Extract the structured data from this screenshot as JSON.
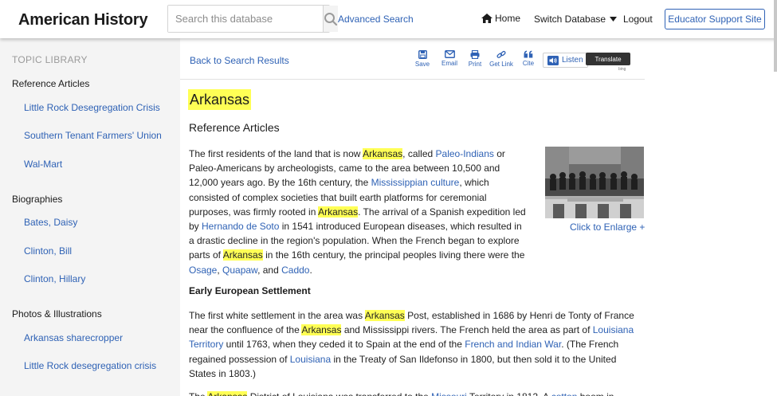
{
  "header": {
    "brand": "American History",
    "search_placeholder": "Search this database",
    "advanced_search": "Advanced Search",
    "home": "Home",
    "switch_database": "Switch Database",
    "logout": "Logout",
    "educator_support": "Educator Support Site"
  },
  "sidebar": {
    "library_title": "TOPIC LIBRARY",
    "groups": [
      {
        "heading": "Reference Articles",
        "items": [
          "Little Rock Desegregation Crisis",
          "Southern Tenant Farmers' Union",
          "Wal-Mart"
        ]
      },
      {
        "heading": "Biographies",
        "items": [
          "Bates, Daisy",
          "Clinton, Bill",
          "Clinton, Hillary"
        ]
      },
      {
        "heading": "Photos & Illustrations",
        "items": [
          "Arkansas sharecropper",
          "Little Rock desegregation crisis"
        ]
      }
    ]
  },
  "toolbar": {
    "back": "Back to Search Results",
    "tools": [
      "Save",
      "Email",
      "Print",
      "Get Link",
      "Cite"
    ],
    "listen": "Listen",
    "translate": "Translate",
    "bing": "bing"
  },
  "article": {
    "title": "Arkansas",
    "section": "Reference Articles",
    "image_caption": "Click to Enlarge +",
    "subheading": "Early European Settlement",
    "paragraph1": [
      {
        "t": "The first residents of the land that is now "
      },
      {
        "t": "Arkansas",
        "s": "hl"
      },
      {
        "t": ", called "
      },
      {
        "t": "Paleo-Indians",
        "s": "lnk"
      },
      {
        "t": " or Paleo-Americans by archeologists, came to the area between 10,500 and 12,000 years ago. By the 16th century, the "
      },
      {
        "t": "Mississippian culture",
        "s": "lnk"
      },
      {
        "t": ", which consisted of complex societies that built earth platforms for ceremonial purposes, was firmly rooted in "
      },
      {
        "t": "Arkansas",
        "s": "hl"
      },
      {
        "t": ". The arrival of a Spanish expedition led by "
      },
      {
        "t": "Hernando de Soto",
        "s": "lnk"
      },
      {
        "t": " in 1541 introduced European diseases, which resulted in a drastic decline in the region's population. When the French began to explore parts of "
      },
      {
        "t": "Arkansas",
        "s": "hl"
      },
      {
        "t": " in the 16th century, the principal peoples living there were the "
      },
      {
        "t": "Osage",
        "s": "lnk"
      },
      {
        "t": ", "
      },
      {
        "t": "Quapaw",
        "s": "lnk"
      },
      {
        "t": ", and "
      },
      {
        "t": "Caddo",
        "s": "lnk"
      },
      {
        "t": "."
      }
    ],
    "paragraph2": [
      {
        "t": "The first white settlement in the area was "
      },
      {
        "t": "Arkansas",
        "s": "hl"
      },
      {
        "t": " Post, established in 1686 by Henri de Tonty of France near the confluence of the "
      },
      {
        "t": "Arkansas",
        "s": "hl"
      },
      {
        "t": " and Mississippi rivers. The French held the area as part of "
      },
      {
        "t": "Louisiana Territory",
        "s": "lnk"
      },
      {
        "t": " until 1763, when they ceded it to Spain at the end of the "
      },
      {
        "t": "French and Indian War",
        "s": "lnk"
      },
      {
        "t": ". (The French regained possession of "
      },
      {
        "t": "Louisiana",
        "s": "lnk"
      },
      {
        "t": " in the Treaty of San Ildefonso in 1800, but then sold it to the United States in 1803.)"
      }
    ],
    "paragraph3": [
      {
        "t": "The "
      },
      {
        "t": "Arkansas",
        "s": "hl"
      },
      {
        "t": " District of Louisiana was transferred to the "
      },
      {
        "t": "Missouri",
        "s": "lnk"
      },
      {
        "t": " Territory in 1812. A "
      },
      {
        "t": "cotton",
        "s": "lnk"
      },
      {
        "t": " boom in"
      }
    ]
  },
  "colors": {
    "link": "#2f62b5",
    "highlight": "#ffff55",
    "sidebar_bg": "#f4f4f4"
  }
}
